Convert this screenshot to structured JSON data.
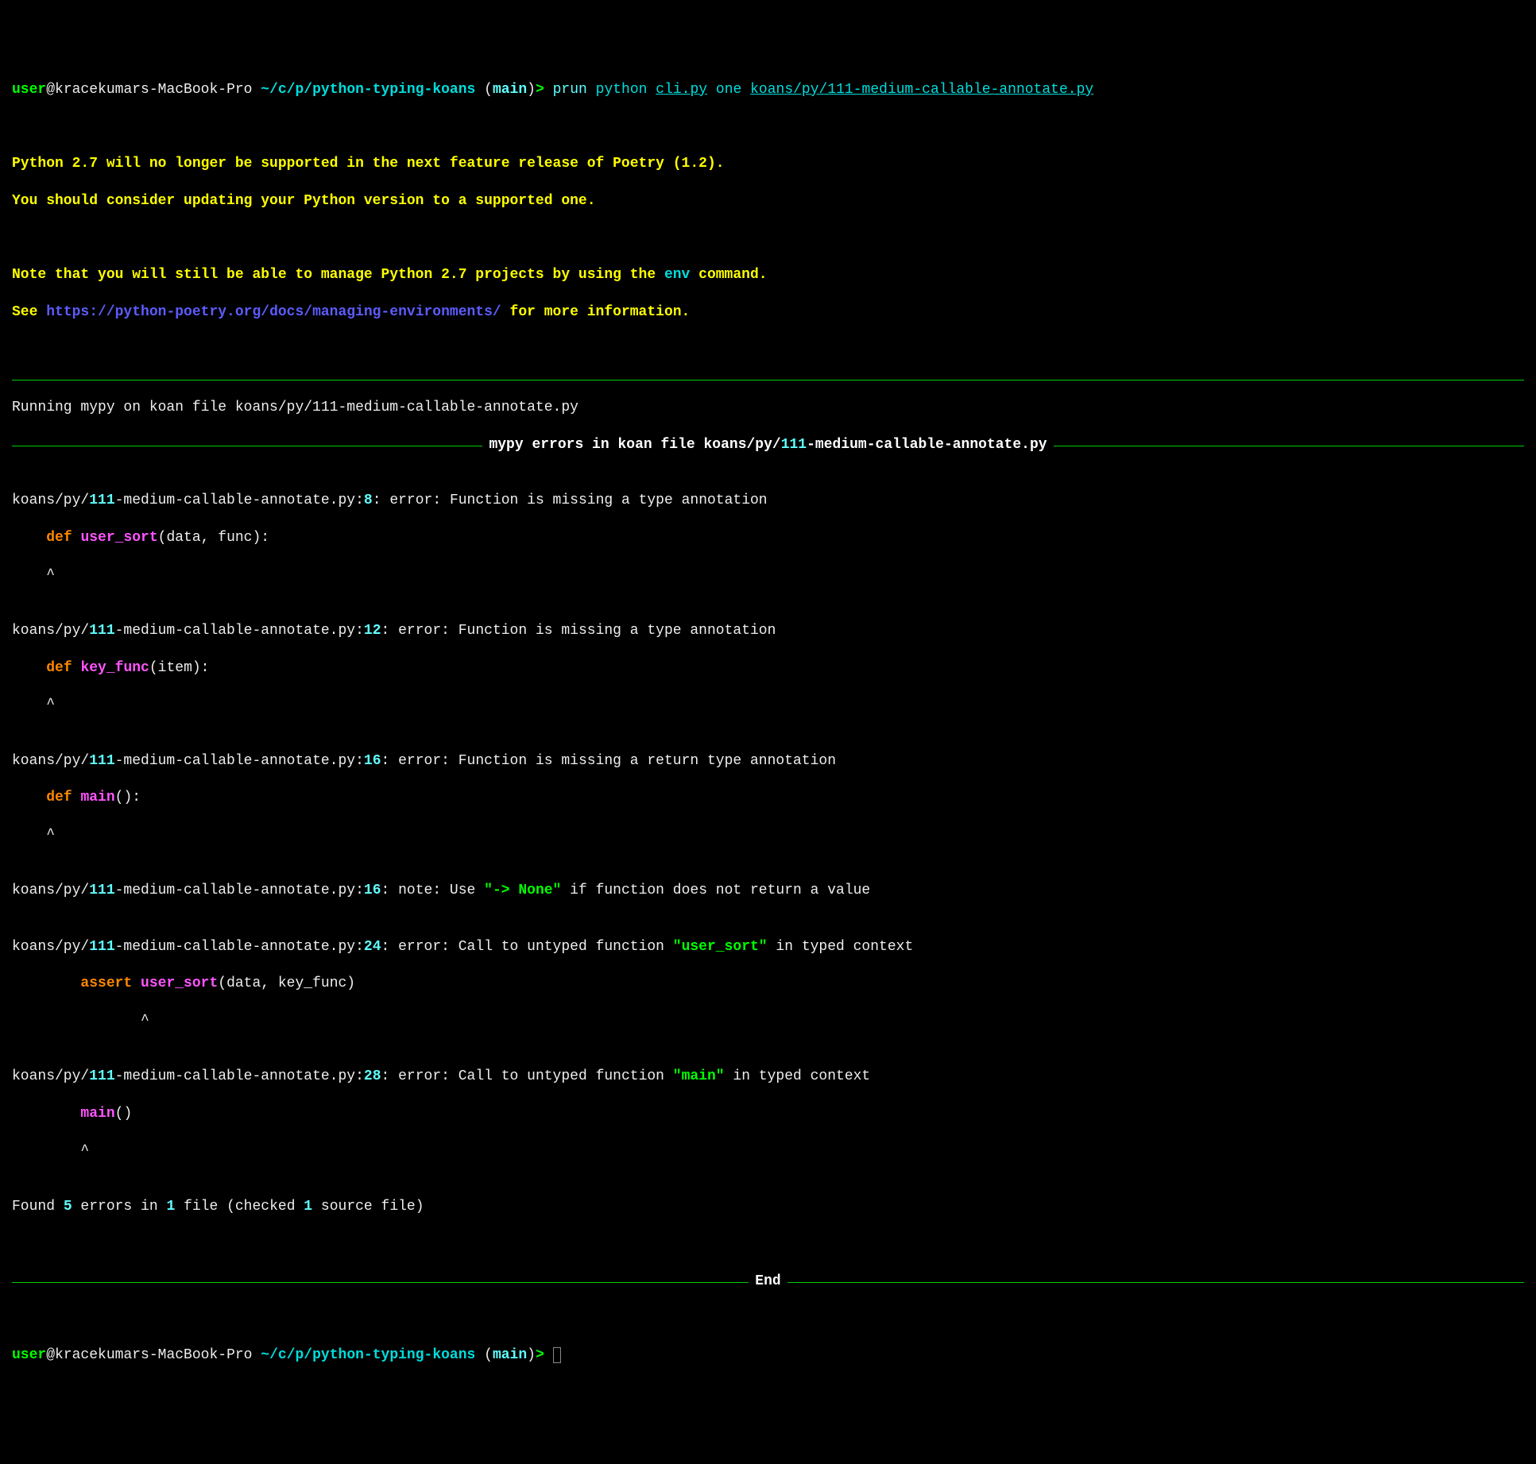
{
  "prompt1": {
    "user": "user",
    "at": "@",
    "host": "kracekumars-MacBook-Pro",
    "path": "~/c/p/python-typing-koans",
    "branch_open": " (",
    "branch": "main",
    "branch_close": ")",
    "arrow": ">",
    "cmd_prun": "prun",
    "cmd_python": "python",
    "cmd_cli": "cli.py",
    "cmd_one": "one",
    "cmd_file": "koans/py/111-medium-callable-annotate.py"
  },
  "warning": {
    "line1": "Python 2.7 will no longer be supported in the next feature release of Poetry (1.2).",
    "line2": "You should consider updating your Python version to a supported one.",
    "line3_a": "Note that you will still be able to manage Python 2.7 projects by using the ",
    "line3_b": "env",
    "line3_c": " command.",
    "line4_a": "See ",
    "line4_b": "https://python-poetry.org/docs/managing-environments/",
    "line4_c": " for more information."
  },
  "running": "Running mypy on koan file koans/py/111-medium-callable-annotate.py",
  "header_title_pre": " mypy errors in koan file koans/py/",
  "header_title_num": "111",
  "header_title_post": "-medium-callable-annotate.py ",
  "errors": [
    {
      "path_pre": "koans/py/",
      "path_num": "111",
      "path_post": "-medium-callable-annotate.py:",
      "line_num": "8",
      "colon": ": ",
      "level": "error: ",
      "msg": "Function is missing a type annotation",
      "code_indent": "    ",
      "code_def": "def ",
      "code_fn": "user_sort",
      "code_args": "(data, func):",
      "caret_line": "    ^"
    },
    {
      "path_pre": "koans/py/",
      "path_num": "111",
      "path_post": "-medium-callable-annotate.py:",
      "line_num": "12",
      "colon": ": ",
      "level": "error: ",
      "msg": "Function is missing a type annotation",
      "code_indent": "    ",
      "code_def": "def ",
      "code_fn": "key_func",
      "code_args": "(item):",
      "caret_line": "    ^"
    },
    {
      "path_pre": "koans/py/",
      "path_num": "111",
      "path_post": "-medium-callable-annotate.py:",
      "line_num": "16",
      "colon": ": ",
      "level": "error: ",
      "msg": "Function is missing a return type annotation",
      "code_indent": "    ",
      "code_def": "def ",
      "code_fn": "main",
      "code_args": "():",
      "caret_line": "    ^"
    }
  ],
  "note": {
    "path_pre": "koans/py/",
    "path_num": "111",
    "path_post": "-medium-callable-annotate.py:",
    "line_num": "16",
    "colon": ": ",
    "level": "note: ",
    "msg_a": "Use ",
    "msg_quote": "\"-> None\"",
    "msg_b": " if function does not return a value"
  },
  "error4": {
    "path_pre": "koans/py/",
    "path_num": "111",
    "path_post": "-medium-callable-annotate.py:",
    "line_num": "24",
    "colon": ": ",
    "level": "error: ",
    "msg_a": "Call to untyped function ",
    "msg_fn": "\"user_sort\"",
    "msg_b": " in typed context",
    "code_indent": "        ",
    "code_assert": "assert ",
    "code_fn": "user_sort",
    "code_args": "(data, key_func)",
    "caret_line": "               ^"
  },
  "error5": {
    "path_pre": "koans/py/",
    "path_num": "111",
    "path_post": "-medium-callable-annotate.py:",
    "line_num": "28",
    "colon": ": ",
    "level": "error: ",
    "msg_a": "Call to untyped function ",
    "msg_fn": "\"main\"",
    "msg_b": " in typed context",
    "code_indent": "        ",
    "code_fn": "main",
    "code_args": "()",
    "caret_line": "        ^"
  },
  "summary": {
    "a": "Found ",
    "n1": "5",
    "b": " errors in ",
    "n2": "1",
    "c": " file (checked ",
    "n3": "1",
    "d": " source file)"
  },
  "end_label": " End ",
  "prompt2": {
    "user": "user",
    "at": "@",
    "host": "kracekumars-MacBook-Pro",
    "path": "~/c/p/python-typing-koans",
    "branch_open": " (",
    "branch": "main",
    "branch_close": ")",
    "arrow": ">"
  }
}
